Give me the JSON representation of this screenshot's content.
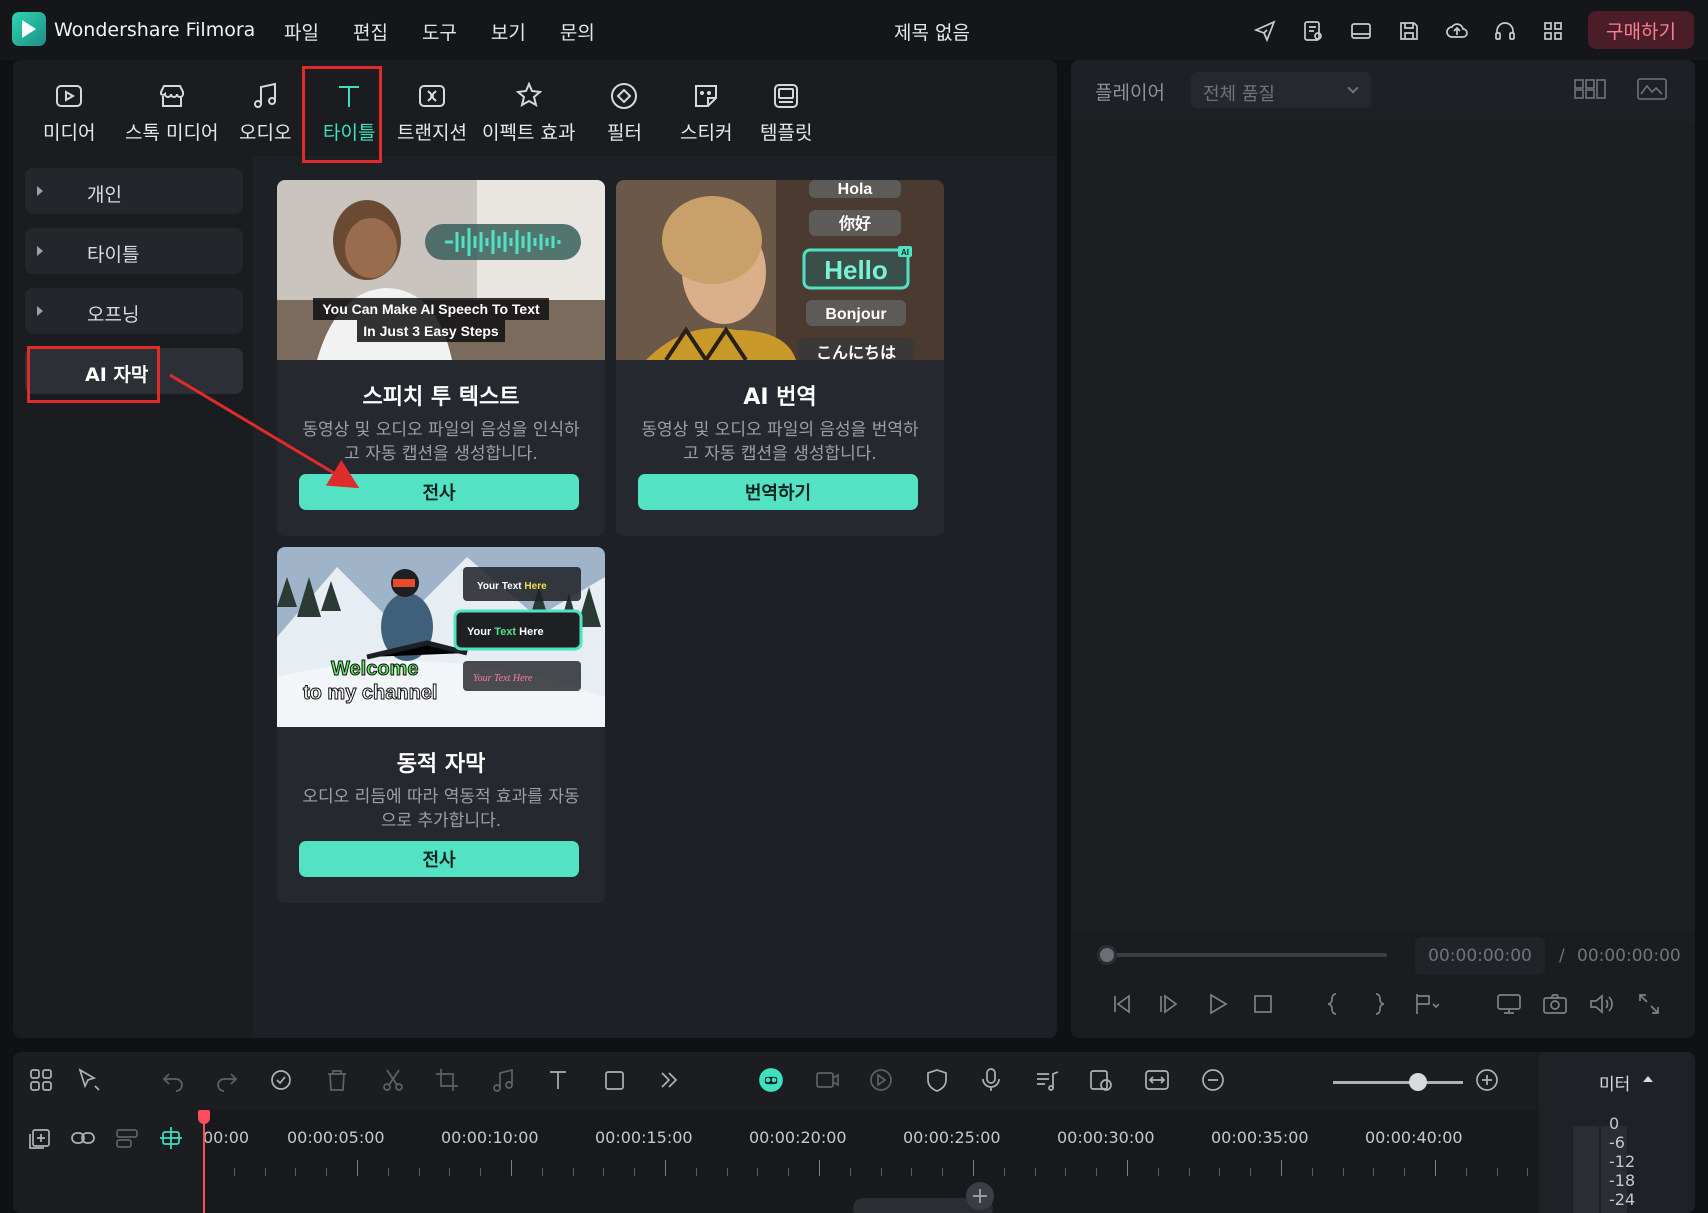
{
  "app": {
    "name": "Wondershare Filmora",
    "doc_title": "제목 없음",
    "buy_label": "구매하기"
  },
  "menu": [
    "파일",
    "편집",
    "도구",
    "보기",
    "문의"
  ],
  "categories": [
    {
      "label": "미디어",
      "icon": "media-icon"
    },
    {
      "label": "스톡 미디어",
      "icon": "stock-media-icon"
    },
    {
      "label": "오디오",
      "icon": "audio-icon"
    },
    {
      "label": "타이틀",
      "icon": "title-icon",
      "active": true
    },
    {
      "label": "트랜지션",
      "icon": "transition-icon"
    },
    {
      "label": "이펙트 효과",
      "icon": "effects-icon"
    },
    {
      "label": "필터",
      "icon": "filter-icon"
    },
    {
      "label": "스티커",
      "icon": "sticker-icon"
    },
    {
      "label": "템플릿",
      "icon": "template-icon"
    }
  ],
  "sidebar": [
    "개인",
    "타이틀",
    "오프닝",
    "AI 자막"
  ],
  "cards": [
    {
      "title": "스피치 투 텍스트",
      "desc": "동영상 및 오디오 파일의 음성을 인식하고 자동 캡션을 생성합니다.",
      "button": "전사",
      "thumb_caption_1": "You Can Make AI Speech To Text",
      "thumb_caption_2": "In Just  3 Easy Steps"
    },
    {
      "title": "AI 번역",
      "desc": "동영상 및 오디오 파일의 음성을 번역하고 자동 캡션을 생성합니다.",
      "button": "번역하기",
      "thumb_words": [
        "Hola",
        "你好",
        "Hello",
        "Bonjour",
        "こんにちは"
      ],
      "thumb_badge": "AI"
    },
    {
      "title": "동적 자막",
      "desc": "오디오 리듬에 따라 역동적 효과를 자동으로 추가합니다.",
      "button": "전사",
      "thumb_line_1": "Welcome",
      "thumb_line_2": "to my channel",
      "thumb_tag_1a": "Your Text ",
      "thumb_tag_1b": "Here",
      "thumb_tag_2a": "Your ",
      "thumb_tag_2b": "Text",
      "thumb_tag_2c": " Here",
      "thumb_tag_3a": "Your ",
      "thumb_tag_3b": "Text",
      "thumb_tag_3c": " Here"
    }
  ],
  "player": {
    "label": "플레이어",
    "quality": "전체 품질",
    "current_time": "00:00:00:00",
    "separator": "/",
    "total_time": "00:00:00:00"
  },
  "timeline": {
    "meter_label": "미터",
    "ruler": [
      "00:00",
      "00:00:05:00",
      "00:00:10:00",
      "00:00:15:00",
      "00:00:20:00",
      "00:00:25:00",
      "00:00:30:00",
      "00:00:35:00",
      "00:00:40:00"
    ],
    "meter_scale": [
      "0",
      "-6",
      "-12",
      "-18",
      "-24"
    ]
  },
  "colors": {
    "accent": "#3fe0c0",
    "highlight": "#e02b2b",
    "button": "#53e2c4",
    "buy": "#ff7e95"
  }
}
